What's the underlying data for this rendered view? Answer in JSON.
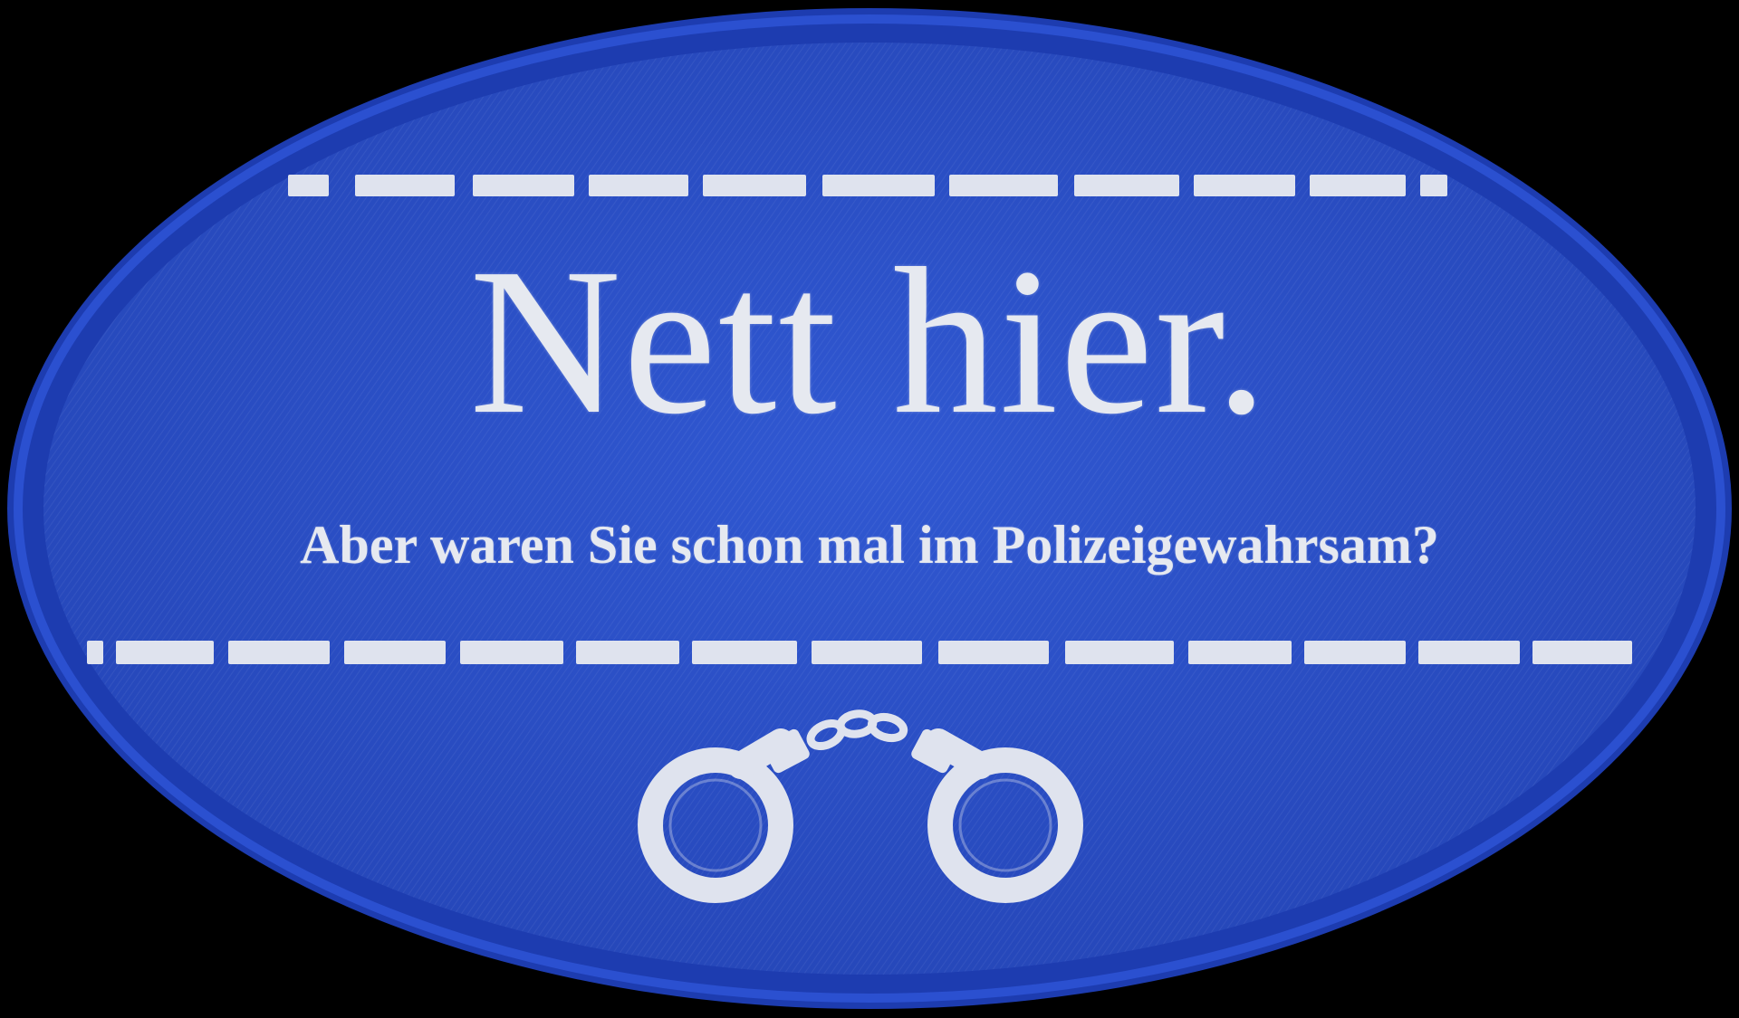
{
  "patch": {
    "headline": "Nett hier.",
    "subline": "Aber waren Sie schon mal im Polizeigewahrsam?",
    "emblem": "handcuffs-icon",
    "colors": {
      "background": "#000000",
      "fabric": "#2a4fc6",
      "border": "#1f3fb8",
      "print": "#e6e9f0"
    }
  }
}
